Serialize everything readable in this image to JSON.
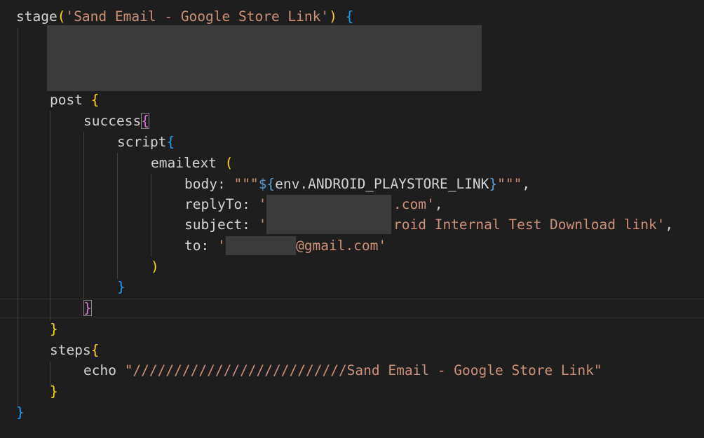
{
  "code": {
    "l1": {
      "kw": "stage",
      "p_open": "(",
      "str": "'Sand Email - Google Store Link'",
      "p_close": ")",
      "brace": "{"
    },
    "l2": {
      "kw": "post",
      "brace": "{"
    },
    "l3": {
      "kw": "success",
      "brace": "{"
    },
    "l4": {
      "kw": "script",
      "brace": "{"
    },
    "l5": {
      "kw": "emailext",
      "paren": "("
    },
    "l6": {
      "key": "body: ",
      "q1": "\"\"\"",
      "tpl_open": "${",
      "var": "env.ANDROID_PLAYSTORE_LINK",
      "tpl_close": "}",
      "q2": "\"\"\"",
      "comma": ","
    },
    "l7": {
      "key": "replyTo: ",
      "q": "'",
      "tail": ".com'",
      "comma": ","
    },
    "l8": {
      "key": "subject: ",
      "q": "'",
      "tail": "roid Internal Test Download link'",
      "comma": ","
    },
    "l9": {
      "key": "to: ",
      "q": "'",
      "tail": "@gmail.com'"
    },
    "l10": {
      "paren": ")"
    },
    "l11": {
      "brace": "}"
    },
    "l12": {
      "brace": "}"
    },
    "l13": {
      "brace": "}"
    },
    "l14": {
      "kw": "steps",
      "brace": "{"
    },
    "l15": {
      "kw": "echo ",
      "str": "\"//////////////////////////Sand Email - Google Store Link\""
    },
    "l16": {
      "brace": "}"
    },
    "l17": {
      "brace": "}"
    }
  },
  "colors": {
    "background": "#1e1e1e",
    "text": "#d4d4d4",
    "string": "#ce9178",
    "bracket_gold": "#ffd700",
    "bracket_orchid": "#da70d6",
    "bracket_blue": "#179fff",
    "redaction": "#3b3b3b"
  }
}
